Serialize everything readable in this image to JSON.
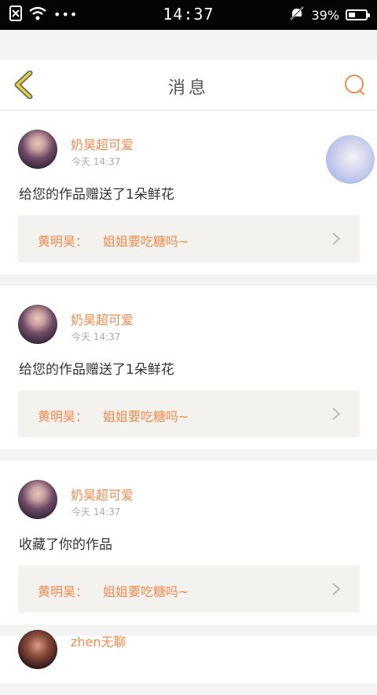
{
  "status_bar": {
    "time": "14:37",
    "dots": "•••",
    "battery": "39%",
    "battery_level": 0.39
  },
  "header": {
    "title": "消息"
  },
  "notifications": [
    {
      "username": "奶昊超可爱",
      "time": "今天 14:37",
      "action": "给您的作品赠送了1朵鲜花",
      "reply_author": "黄明昊：",
      "reply_text": "姐姐要吃糖吗~",
      "has_thumbnail": true
    },
    {
      "username": "奶昊超可爱",
      "time": "今天 14:37",
      "action": "给您的作品赠送了1朵鲜花",
      "reply_author": "黄明昊：",
      "reply_text": "姐姐要吃糖吗~",
      "has_thumbnail": false
    },
    {
      "username": "奶昊超可爱",
      "time": "今天 14:37",
      "action": "收藏了你的作品",
      "reply_author": "黄明昊：",
      "reply_text": "姐姐要吃糖吗~",
      "has_thumbnail": false
    },
    {
      "username": "zhen无聊"
    }
  ],
  "colors": {
    "accent": "#f08a4b",
    "back_arrow": "#e1d23a",
    "status_bar_bg": "#050505"
  }
}
